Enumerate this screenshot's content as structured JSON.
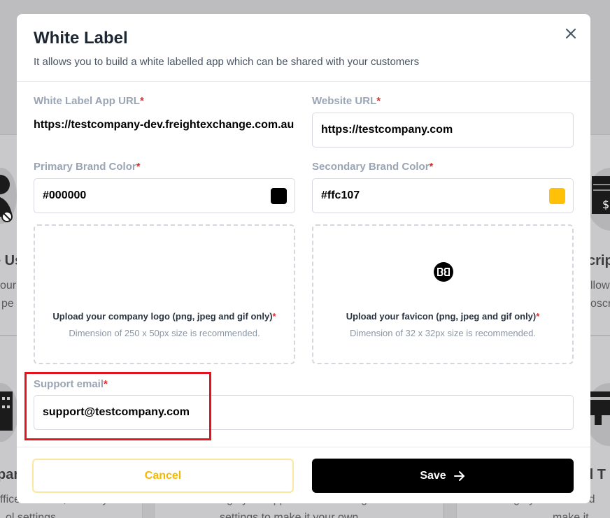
{
  "modal": {
    "title": "White Label",
    "subtitle": "It allows you to build a white labelled app which can be shared with your customers",
    "close_icon": "close-icon"
  },
  "fields": {
    "app_url": {
      "label": "White Label App URL",
      "required": "*",
      "value": "https://testcompany-dev.freightexchange.com.au"
    },
    "website_url": {
      "label": "Website URL",
      "required": "*",
      "value": "https://testcompany.com"
    },
    "primary_color": {
      "label": "Primary Brand Color",
      "required": "*",
      "value": "#000000",
      "swatch": "#000000"
    },
    "secondary_color": {
      "label": "Secondary Brand Color",
      "required": "*",
      "value": "#ffc107",
      "swatch": "#ffc107"
    },
    "support_email": {
      "label": "Support email",
      "required": "*",
      "value": "support@testcompany.com"
    }
  },
  "uploads": {
    "logo": {
      "title": "Upload your company logo (png, jpeg and gif only)",
      "required": "*",
      "hint": "Dimension of 250 x 50px size is recommended."
    },
    "favicon": {
      "title": "Upload your favicon (png, jpeg and gif only)",
      "required": "*",
      "hint": "Dimension of 32 x 32px size is recommended.",
      "icon": "favicon-logo-icon"
    }
  },
  "footer": {
    "cancel_label": "Cancel",
    "save_label": "Save",
    "save_icon": "arrow-right-icon"
  },
  "background": {
    "left_heading_1": "e Us",
    "left_sub_1a": "our",
    "left_sub_1b": "pe",
    "right_heading_1": "crip",
    "right_sub_1a": "llow",
    "right_sub_1b": "oscr",
    "left_heading_2": "pan",
    "left_sub_2": "ffice address, delivery",
    "left_sub_2b": "ol settings",
    "mid_sub_2": "Manage your application branding &",
    "mid_sub_2b": "settings to make it your own",
    "right_heading_2": "d T",
    "right_sub_2": "Manage your branded",
    "right_sub_2b": "make it"
  },
  "colors": {
    "accent": "#ffc107",
    "highlight": "#e3141e",
    "required": "#e02b2b"
  }
}
